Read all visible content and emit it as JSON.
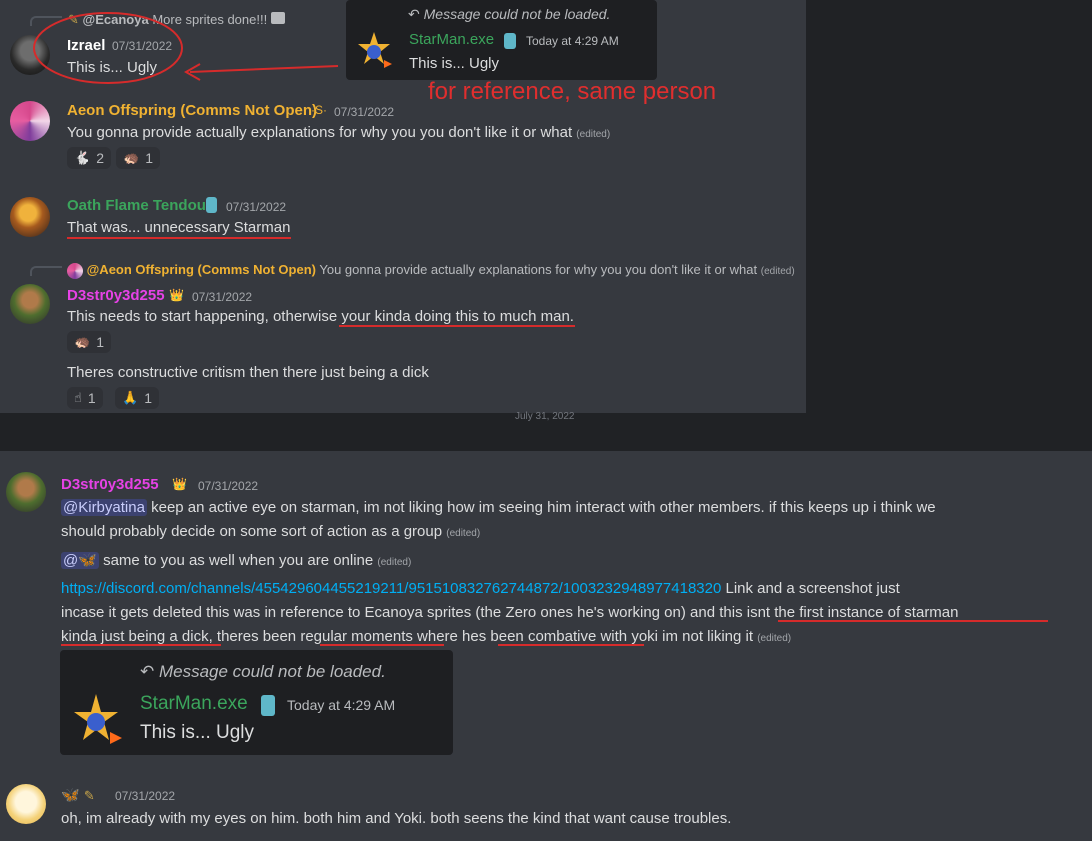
{
  "top_panel": {
    "reply_izrael": {
      "author": "@Ecanoya",
      "text": "More sprites done!!!"
    },
    "izrael": {
      "name": "Izrael",
      "timestamp": "07/31/2022",
      "text": "This is... Ugly"
    },
    "embed": {
      "header": "Message could not be loaded.",
      "author": "StarMan.exe",
      "timestamp": "Today at 4:29 AM",
      "text": "This is... Ugly"
    },
    "annotation": "for reference, same person",
    "aeon": {
      "name": "Aeon Offspring (Comms Not Open)",
      "badge": "·S·",
      "timestamp": "07/31/2022",
      "text": "You gonna provide actually explanations for why you you don't like it or what",
      "edited": "(edited)",
      "reactions": [
        {
          "emoji": "🐇",
          "count": "2"
        },
        {
          "emoji": "🦔",
          "count": "1"
        }
      ]
    },
    "oath": {
      "name": "Oath Flame Tendou",
      "timestamp": "07/31/2022",
      "text": "That was... unnecessary Starman"
    },
    "reply_d3": {
      "author": "@Aeon Offspring (Comms Not Open)",
      "text": "You gonna provide actually explanations for why you you don't like it or what",
      "edited": "(edited)"
    },
    "d3": {
      "name": "D3str0y3d255",
      "timestamp": "07/31/2022",
      "text1": "This needs to start happening, otherwise your kinda doing this to much man.",
      "reaction1": {
        "emoji": "🦔",
        "count": "1"
      },
      "text2": "Theres constructive critism then there just being a dick",
      "reactions2": [
        {
          "emoji": "☝",
          "count": "1"
        },
        {
          "emoji": "🙏",
          "count": "1"
        }
      ]
    }
  },
  "bottom_panel": {
    "divider": "July 31, 2022",
    "d3": {
      "name": "D3str0y3d255",
      "timestamp": "07/31/2022",
      "mention1": "@Kirbyatina",
      "line1a": "keep an active eye on starman, im not liking how im seeing him interact with other members. if this keeps up i think we",
      "line1b": "should probably decide on some sort of action as a group",
      "edited": "(edited)",
      "mention2": "@🦋",
      "line2": "same to you as well when you are online",
      "link": "https://discord.com/channels/455429604455219211/951510832762744872/1003232948977418320",
      "line3a": "Link and a screenshot just",
      "line3b": "incase it gets deleted this was in reference to Ecanoya sprites (the Zero ones he's working on) and this isnt the first instance of starman",
      "line3c": "kinda just being a dick, theres been regular moments where hes been combative with yoki im not liking it"
    },
    "embed": {
      "header": "Message could not be loaded.",
      "author": "StarMan.exe",
      "timestamp": "Today at 4:29 AM",
      "text": "This is... Ugly"
    },
    "last": {
      "name_emoji": "🦋",
      "timestamp": "07/31/2022",
      "text": "oh, im already with my eyes on him. both him and Yoki. both seens the kind that want cause troubles."
    }
  },
  "colors": {
    "background": "#36393f",
    "green": "#3ba55c",
    "yellow": "#f0b232",
    "magenta": "#e642e6",
    "red": "#e02e2e",
    "link": "#00aff4"
  }
}
